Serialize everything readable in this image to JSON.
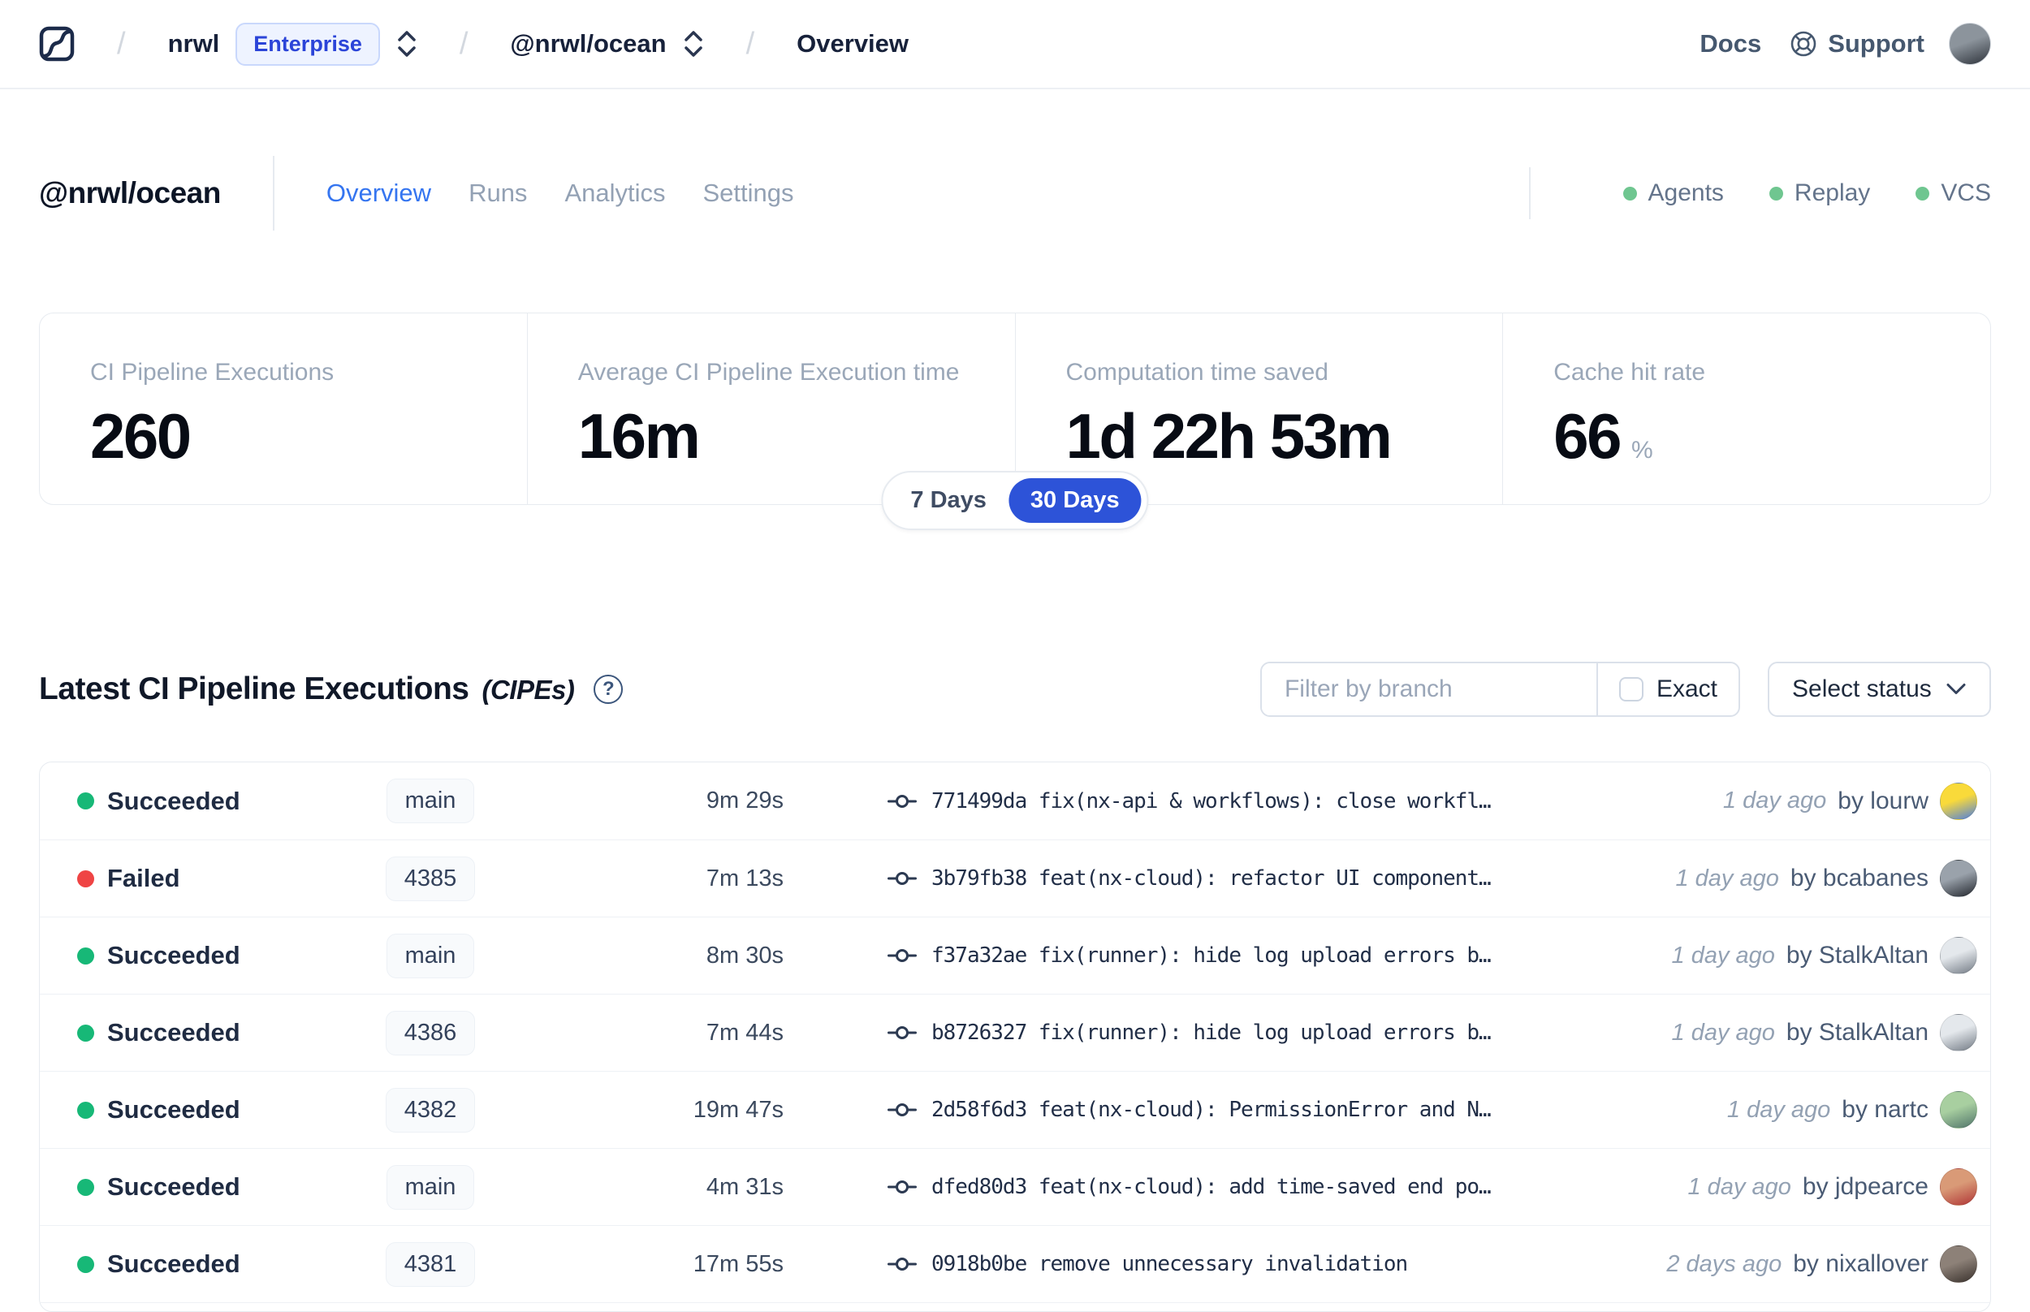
{
  "colors": {
    "accent_blue": "#2d53d8",
    "tab_active": "#3575f0",
    "badge_text": "#2b44d8",
    "badge_bg": "#eef3ff",
    "badge_border": "#c9d8fc",
    "card_border": "#e7ebf0",
    "success_green": "#17b877",
    "failed_red": "#ef4444",
    "indicator_green": "#6fc690"
  },
  "nav": {
    "breadcrumb": {
      "org": "nrwl",
      "org_badge": "Enterprise",
      "workspace": "@nrwl/ocean",
      "page": "Overview",
      "separator": "/"
    },
    "links": {
      "docs": "Docs",
      "support": "Support"
    },
    "user_avatar_colors": [
      "#8c949c",
      "#2e333b"
    ]
  },
  "header": {
    "title": "@nrwl/ocean",
    "tabs": [
      "Overview",
      "Runs",
      "Analytics",
      "Settings"
    ],
    "active_tab": "Overview",
    "indicators": [
      {
        "label": "Agents",
        "color": "#6fc690"
      },
      {
        "label": "Replay",
        "color": "#6fc690"
      },
      {
        "label": "VCS",
        "color": "#6fc690"
      }
    ]
  },
  "stats": {
    "period_options": [
      "7 Days",
      "30 Days"
    ],
    "selected_period": "30 Days",
    "cards": [
      {
        "label": "CI Pipeline Executions",
        "value": "260",
        "suffix": ""
      },
      {
        "label": "Average CI Pipeline Execution time",
        "value": "16m",
        "suffix": ""
      },
      {
        "label": "Computation time saved",
        "value": "1d 22h 53m",
        "suffix": ""
      },
      {
        "label": "Cache hit rate",
        "value": "66",
        "suffix": "%"
      }
    ]
  },
  "cipes": {
    "title": "Latest CI Pipeline Executions",
    "title_suffix": "(CIPEs)",
    "help_glyph": "?",
    "filter": {
      "placeholder": "Filter by branch",
      "exact_label": "Exact"
    },
    "status_select_label": "Select status",
    "rows": [
      {
        "status": "Succeeded",
        "status_color": "#17b877",
        "branch": "main",
        "duration": "9m 29s",
        "commit": "771499da fix(nx-api & workflows): close workfl…",
        "time_ago": "1 day ago",
        "author": "by lourw",
        "avatar": [
          "#f9da3a",
          "#4d7ee0"
        ]
      },
      {
        "status": "Failed",
        "status_color": "#ef4444",
        "branch": "4385",
        "duration": "7m 13s",
        "commit": "3b79fb38 feat(nx-cloud): refactor UI component…",
        "time_ago": "1 day ago",
        "author": "by bcabanes",
        "avatar": [
          "#9aa2ab",
          "#23272e"
        ]
      },
      {
        "status": "Succeeded",
        "status_color": "#17b877",
        "branch": "main",
        "duration": "8m 30s",
        "commit": "f37a32ae fix(runner): hide log upload errors b…",
        "time_ago": "1 day ago",
        "author": "by StalkAltan",
        "avatar": [
          "#e4e8ec",
          "#737b85"
        ]
      },
      {
        "status": "Succeeded",
        "status_color": "#17b877",
        "branch": "4386",
        "duration": "7m 44s",
        "commit": "b8726327 fix(runner): hide log upload errors b…",
        "time_ago": "1 day ago",
        "author": "by StalkAltan",
        "avatar": [
          "#e4e8ec",
          "#737b85"
        ]
      },
      {
        "status": "Succeeded",
        "status_color": "#17b877",
        "branch": "4382",
        "duration": "19m 47s",
        "commit": "2d58f6d3 feat(nx-cloud): PermissionError and N…",
        "time_ago": "1 day ago",
        "author": "by nartc",
        "avatar": [
          "#a8cfa0",
          "#51756a"
        ]
      },
      {
        "status": "Succeeded",
        "status_color": "#17b877",
        "branch": "main",
        "duration": "4m 31s",
        "commit": "dfed80d3 feat(nx-cloud): add time-saved end po…",
        "time_ago": "1 day ago",
        "author": "by jdpearce",
        "avatar": [
          "#d99a77",
          "#b03636"
        ]
      },
      {
        "status": "Succeeded",
        "status_color": "#17b877",
        "branch": "4381",
        "duration": "17m 55s",
        "commit": "0918b0be remove unnecessary invalidation",
        "time_ago": "2 days ago",
        "author": "by nixallover",
        "avatar": [
          "#8d8178",
          "#3a322d"
        ]
      }
    ]
  }
}
